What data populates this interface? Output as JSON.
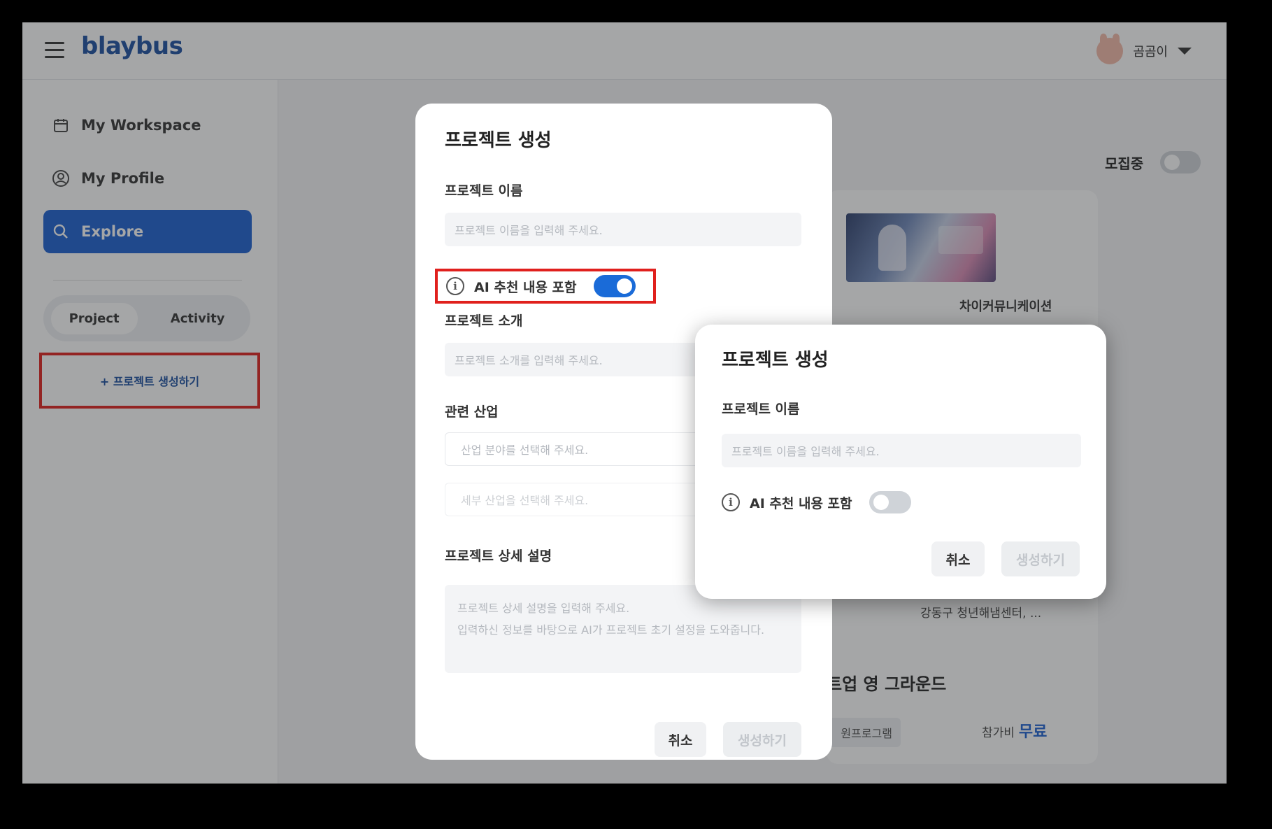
{
  "header": {
    "logo": "blaybus",
    "user_name": "곰곰이"
  },
  "sidebar": {
    "items": [
      {
        "label": "My Workspace",
        "icon": "calendar-icon"
      },
      {
        "label": "My Profile",
        "icon": "user-circle-icon"
      },
      {
        "label": "Explore",
        "icon": "explore-icon"
      }
    ],
    "tabs": [
      "Project",
      "Activity"
    ],
    "create_link": "+ 프로젝트 생성하기"
  },
  "background": {
    "recruiting_label": "모집중",
    "card_org": "차이커뮤니케이션",
    "card_location": "강동구 청년해냄센터, ...",
    "card_title_partial": "트업 영 그라운드",
    "card_tag_partial": "원프로그램",
    "fee_label": "참가비",
    "fee_value": "무료"
  },
  "modal_full": {
    "title": "프로젝트 생성",
    "name_label": "프로젝트 이름",
    "name_placeholder": "프로젝트 이름을 입력해 주세요.",
    "ai_label": "AI 추천 내용 포함",
    "ai_toggle": "on",
    "intro_label": "프로젝트 소개",
    "intro_placeholder": "프로젝트 소개를 입력해 주세요.",
    "industry_label": "관련 산업",
    "industry_placeholder": "산업 분야를 선택해 주세요.",
    "sub_industry_placeholder": "세부 산업을 선택해 주세요.",
    "detail_label": "프로젝트 상세 설명",
    "detail_placeholder_line1": "프로젝트 상세 설명을 입력해 주세요.",
    "detail_placeholder_line2": "입력하신 정보를 바탕으로 AI가 프로젝트 초기 설정을 도와줍니다.",
    "cancel": "취소",
    "create": "생성하기"
  },
  "modal_compact": {
    "title": "프로젝트 생성",
    "name_label": "프로젝트 이름",
    "name_placeholder": "프로젝트 이름을 입력해 주세요.",
    "ai_label": "AI 추천 내용 포함",
    "ai_toggle": "off",
    "cancel": "취소",
    "create": "생성하기"
  },
  "colors": {
    "accent": "#1a5fd1",
    "highlight": "#e0201d"
  }
}
